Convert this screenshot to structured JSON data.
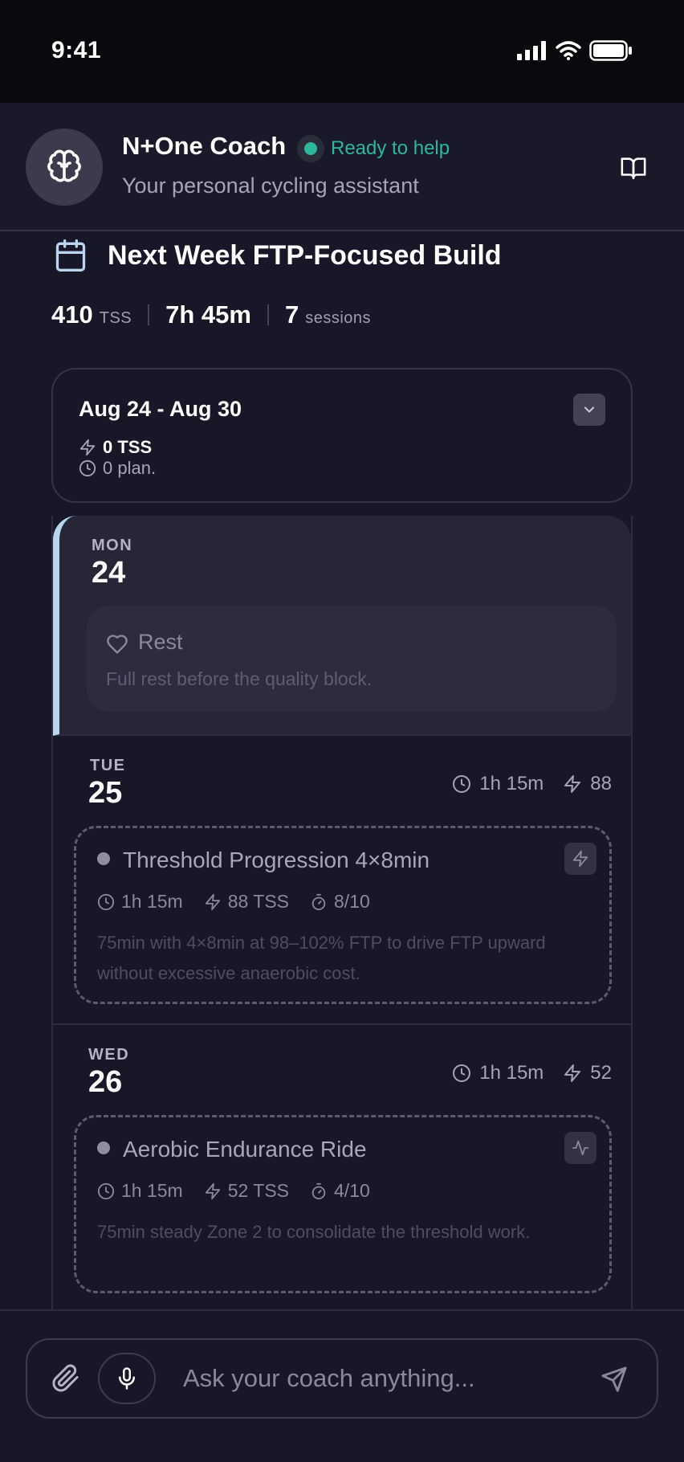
{
  "status_bar": {
    "time": "9:41"
  },
  "header": {
    "title": "N+One Coach",
    "status": "Ready to help",
    "subtitle": "Your personal cycling assistant",
    "status_color": "#2bb99a"
  },
  "plan": {
    "title": "Next Week FTP-Focused Build",
    "stats": [
      {
        "value": "410",
        "unit": "TSS"
      },
      {
        "value": "7h 45m",
        "unit": ""
      },
      {
        "value": "7",
        "unit": "sessions"
      }
    ]
  },
  "week": {
    "range": "Aug 24 - Aug 30",
    "tss": "0 TSS",
    "planned": "0 plan."
  },
  "days": [
    {
      "name": "MON",
      "num": "24",
      "type": "rest",
      "rest_label": "Rest",
      "rest_desc": "Full rest before the quality block."
    },
    {
      "name": "TUE",
      "num": "25",
      "duration": "1h 15m",
      "tss": "88",
      "workout": {
        "title": "Threshold Progression 4×8min",
        "duration": "1h 15m",
        "tss": "88 TSS",
        "rpe": "8/10",
        "desc": "75min with 4×8min at 98–102% FTP to drive FTP upward without excessive anaerobic cost.",
        "icon": "bolt-icon"
      }
    },
    {
      "name": "WED",
      "num": "26",
      "duration": "1h 15m",
      "tss": "52",
      "workout": {
        "title": "Aerobic Endurance Ride",
        "duration": "1h 15m",
        "tss": "52 TSS",
        "rpe": "4/10",
        "desc": "75min steady Zone 2 to consolidate the threshold work.",
        "icon": "activity-icon"
      }
    }
  ],
  "input": {
    "placeholder": "Ask your coach anything..."
  },
  "colors": {
    "background": "#181727",
    "accent": "#2bb99a",
    "rest_bar": "#b9d6ee"
  }
}
